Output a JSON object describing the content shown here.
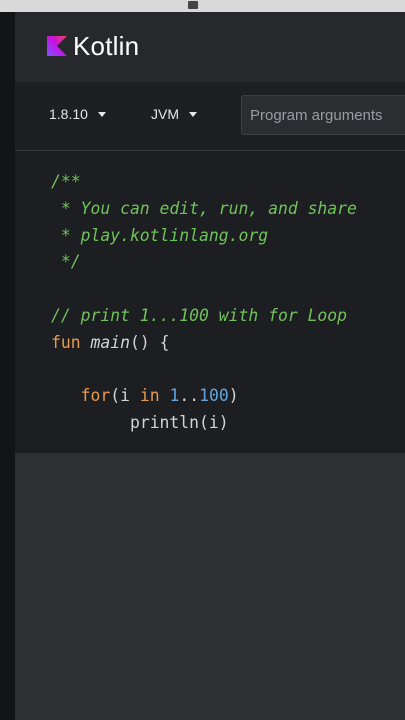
{
  "header": {
    "brand": "Kotlin",
    "logo_icon": "kotlin-logo-icon",
    "logo_colors": [
      "#7f52ff",
      "#c711e1",
      "#e44857"
    ]
  },
  "toolbar": {
    "version": "1.8.10",
    "target": "JVM",
    "args_placeholder": "Program arguments"
  },
  "editor": {
    "line1": "/**",
    "line2": " * You can edit, run, and share",
    "line3": " * play.kotlinlang.org",
    "line4": " */",
    "line6": "// print 1...100 with for Loop",
    "kw_fun": "fun",
    "fn_main": "main",
    "main_rest": "() {",
    "kw_for": "for",
    "for_open": "(i ",
    "kw_in": "in",
    "range_num_1": "1",
    "range_dots": "..",
    "range_num_2": "100",
    "for_close": ")",
    "println_call": "println(i)"
  },
  "colors": {
    "comment": "#6fc35a",
    "keyword": "#e89a4e",
    "number": "#63a5e0",
    "text": "#d4d4d4"
  }
}
